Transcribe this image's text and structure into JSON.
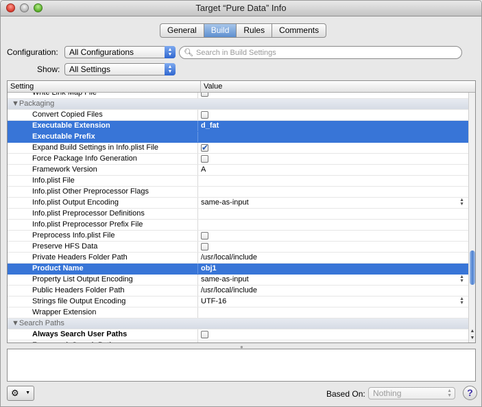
{
  "window": {
    "title": "Target “Pure Data” Info"
  },
  "tabs": [
    {
      "label": "General",
      "active": false
    },
    {
      "label": "Build",
      "active": true
    },
    {
      "label": "Rules",
      "active": false
    },
    {
      "label": "Comments",
      "active": false
    }
  ],
  "config": {
    "label": "Configuration:",
    "value": "All Configurations"
  },
  "show": {
    "label": "Show:",
    "value": "All Settings"
  },
  "search": {
    "placeholder": "Search in Build Settings"
  },
  "table": {
    "headers": {
      "setting": "Setting",
      "value": "Value"
    },
    "rows": [
      {
        "name": "Write Link Map File",
        "kind": "cut",
        "value_type": "checkbox",
        "checked": false
      },
      {
        "name": "▼Packaging",
        "kind": "group"
      },
      {
        "name": "Convert Copied Files",
        "value_type": "checkbox",
        "checked": false
      },
      {
        "name": "Executable Extension",
        "kind": "selected",
        "value": "d_fat"
      },
      {
        "name": "Executable Prefix",
        "kind": "selected",
        "value": ""
      },
      {
        "name": "Expand Build Settings in Info.plist File",
        "value_type": "checkbox",
        "checked": true
      },
      {
        "name": "Force Package Info Generation",
        "value_type": "checkbox",
        "checked": false
      },
      {
        "name": "Framework Version",
        "value": "A"
      },
      {
        "name": "Info.plist File",
        "value": ""
      },
      {
        "name": "Info.plist Other Preprocessor Flags",
        "value": ""
      },
      {
        "name": "Info.plist Output Encoding",
        "value": "same-as-input",
        "stepper": true
      },
      {
        "name": "Info.plist Preprocessor Definitions",
        "value": ""
      },
      {
        "name": "Info.plist Preprocessor Prefix File",
        "value": ""
      },
      {
        "name": "Preprocess Info.plist File",
        "value_type": "checkbox",
        "checked": false
      },
      {
        "name": "Preserve HFS Data",
        "value_type": "checkbox",
        "checked": false
      },
      {
        "name": "Private Headers Folder Path",
        "value": "/usr/local/include"
      },
      {
        "name": "Product Name",
        "kind": "selected",
        "value": "obj1"
      },
      {
        "name": "Property List Output Encoding",
        "value": "same-as-input",
        "stepper": true
      },
      {
        "name": "Public Headers Folder Path",
        "value": "/usr/local/include"
      },
      {
        "name": "Strings file Output Encoding",
        "value": "UTF-16",
        "stepper": true
      },
      {
        "name": "Wrapper Extension",
        "value": ""
      },
      {
        "name": "▼Search Paths",
        "kind": "group"
      },
      {
        "name": "Always Search User Paths",
        "kind": "bold",
        "value_type": "checkbox",
        "checked": false
      },
      {
        "name": "Framework Search Paths",
        "kind": "cut",
        "value": ""
      }
    ]
  },
  "footer": {
    "gear_icon": "gear-icon",
    "based_on_label": "Based On:",
    "based_on_value": "Nothing",
    "help_label": "?"
  }
}
